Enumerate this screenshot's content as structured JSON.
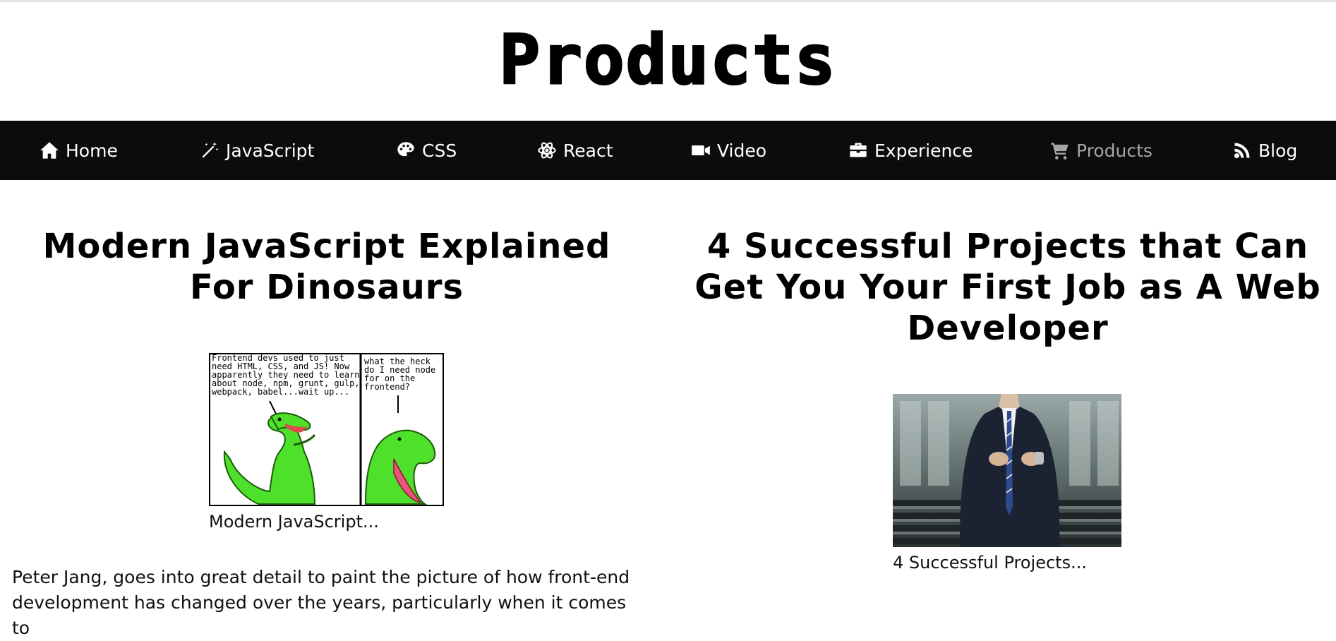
{
  "site": {
    "title": "Products"
  },
  "nav": {
    "items": [
      {
        "label": "Home",
        "icon": "home-icon",
        "active": false
      },
      {
        "label": "JavaScript",
        "icon": "magic-wand-icon",
        "active": false
      },
      {
        "label": "CSS",
        "icon": "palette-icon",
        "active": false
      },
      {
        "label": "React",
        "icon": "atom-icon",
        "active": false
      },
      {
        "label": "Video",
        "icon": "video-camera-icon",
        "active": false
      },
      {
        "label": "Experience",
        "icon": "briefcase-icon",
        "active": false
      },
      {
        "label": "Products",
        "icon": "shopping-cart-icon",
        "active": true
      },
      {
        "label": "Blog",
        "icon": "rss-feed-icon",
        "active": false
      }
    ],
    "active_color": "#a6a6a6",
    "background": "#0c0c0c"
  },
  "posts": [
    {
      "title": "Modern JavaScript Explained For Dinosaurs",
      "image": {
        "panel_left_text": "Frontend devs used to just need HTML, CSS, and JS! Now apparently they need to learn about node, npm, grunt, gulp, webpack, babel...wait up...",
        "panel_right_text": "what the heck do I need node for on the frontend?"
      },
      "caption": "Modern JavaScript...",
      "excerpt": "Peter Jang, goes into great detail to paint the picture of how front-end development has changed over the years, particularly when it comes to"
    },
    {
      "title": "4 Successful Projects that Can Get You Your First Job as A Web Developer",
      "image": {
        "subject": "man-in-suit-photo"
      },
      "caption": "4 Successful Projects..."
    }
  ]
}
